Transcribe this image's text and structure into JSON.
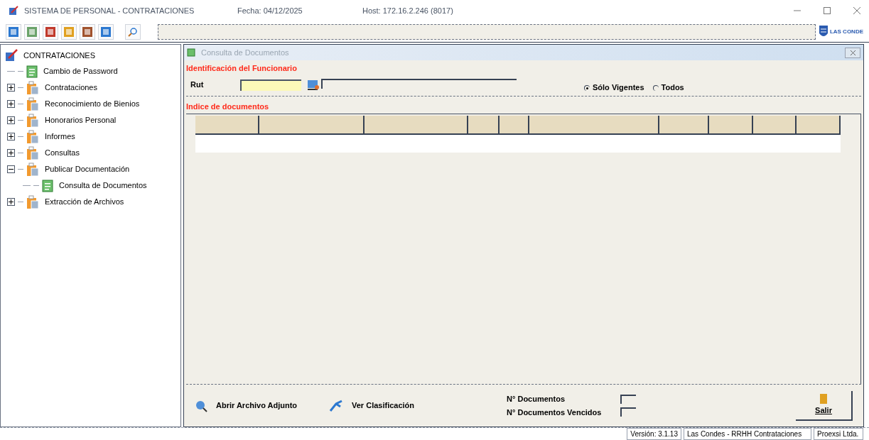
{
  "window": {
    "title": "SISTEMA DE PERSONAL - CONTRATACIONES",
    "date": "Fecha: 04/12/2025",
    "host": "Host: 172.16.2.246  (8017)"
  },
  "logo_text": "LAS CONDE",
  "tree": {
    "label": "CONTRATACIONES",
    "children": [
      {
        "label": "Cambio de Password",
        "kind": "form"
      },
      {
        "label": "Contrataciones",
        "kind": "folder",
        "expanded": false
      },
      {
        "label": "Reconocimiento de Bienios",
        "kind": "folder",
        "expanded": false
      },
      {
        "label": "Honorarios Personal",
        "kind": "folder",
        "expanded": false
      },
      {
        "label": "Informes",
        "kind": "folder",
        "expanded": false
      },
      {
        "label": "Consultas",
        "kind": "folder",
        "expanded": false
      },
      {
        "label": "Publicar Documentación",
        "kind": "folder",
        "expanded": true,
        "children": [
          {
            "label": "Consulta de Documentos",
            "kind": "form"
          }
        ]
      },
      {
        "label": "Extracción de Archivos",
        "kind": "folder",
        "expanded": false
      }
    ]
  },
  "dialog": {
    "title": "Consulta de Documentos",
    "section1": "Identificación del Funcionario",
    "rut_label": "Rut",
    "radios": [
      {
        "label": "Sólo Vigentes",
        "selected": true
      },
      {
        "label": "Todos",
        "selected": false
      }
    ],
    "section2": "Indice de documentos",
    "buttons": [
      "Abrir Archivo Adjunto",
      "Ver Clasificación"
    ],
    "counts": [
      "N° Documentos",
      "N° Documentos Vencidos"
    ],
    "exit": "Salir"
  },
  "status_bar": [
    "Versión: 3.1.13",
    "Las Condes - RRHH Contrataciones",
    "Proexsi Ltda."
  ]
}
